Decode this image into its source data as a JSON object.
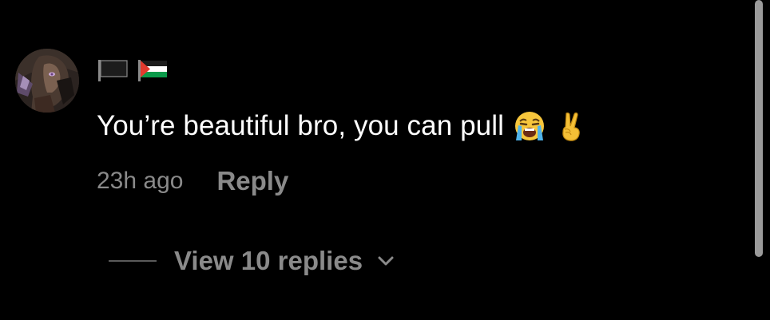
{
  "comment": {
    "text": "You’re beautiful bro, you can pull",
    "emojis": [
      "loudly-crying-face-icon",
      "victory-hand-icon"
    ],
    "timestamp": "23h ago",
    "reply_label": "Reply",
    "username_flags": [
      "black-flag-icon",
      "palestine-flag-icon"
    ]
  },
  "replies": {
    "view_label": "View 10 replies",
    "icon": "chevron-down-icon"
  },
  "colors": {
    "background": "#000000",
    "primary_text": "#ffffff",
    "secondary_text": "#8a8a8a",
    "divider": "#5a5a5a",
    "scrollbar": "#9a9a9a"
  }
}
